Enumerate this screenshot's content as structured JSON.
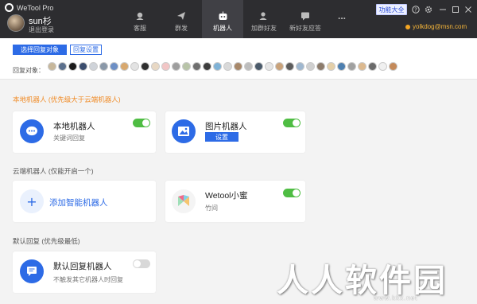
{
  "app": {
    "title": "WeTool Pro"
  },
  "user": {
    "name": "sun杉",
    "logout": "退出登录",
    "email": "yolkdog@msn.com"
  },
  "nav": {
    "items": [
      {
        "label": "客服",
        "icon": "headset-icon"
      },
      {
        "label": "群发",
        "icon": "send-icon"
      },
      {
        "label": "机器人",
        "icon": "robot-icon"
      },
      {
        "label": "加群好友",
        "icon": "add-friend-icon"
      },
      {
        "label": "新好友应答",
        "icon": "chat-bubble-icon"
      },
      {
        "label": "...",
        "icon": "more-icon"
      }
    ],
    "active_index": 2
  },
  "header_buttons": {
    "features": "功能大全"
  },
  "toolbar": {
    "select_targets": "选择回复对象",
    "reply_settings": "回复设置",
    "reply_targets_label": "回复对象："
  },
  "sections": {
    "local": "本地机器人 (优先级大于云端机器人)",
    "cloud": "云端机器人 (仅能开启一个)",
    "default": "默认回复 (优先级最低)"
  },
  "cards": {
    "local_robot": {
      "title": "本地机器人",
      "sub": "关键词回复",
      "enabled": true
    },
    "image_robot": {
      "title": "图片机器人",
      "button": "设置",
      "enabled": true
    },
    "add_robot": {
      "title": "添加智能机器人",
      "plus": "+"
    },
    "wetool_mi": {
      "title": "Wetool小蜜",
      "sub": "竹间",
      "enabled": true
    },
    "default_robot": {
      "title": "默认回复机器人",
      "sub": "不触发其它机器人时回复",
      "enabled": false
    }
  },
  "colors": {
    "header_bg": "#2d2d30",
    "accent_blue": "#2d6be6",
    "toggle_on": "#4fbd43",
    "section_orange": "#f08a24",
    "email_orange": "#f5b53a"
  },
  "watermark": {
    "text": "人人软件园",
    "url": "www.kkx.net"
  }
}
